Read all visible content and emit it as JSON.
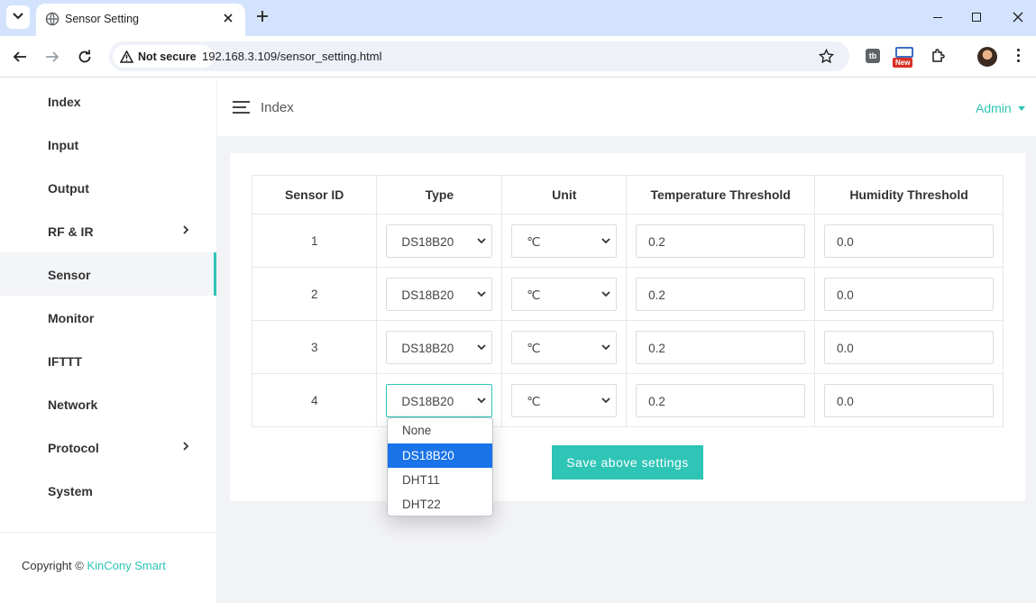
{
  "browser": {
    "tab_title": "Sensor Setting",
    "security_label": "Not secure",
    "url": "192.168.3.109/sensor_setting.html",
    "new_badge": "New",
    "ext_label": "tb"
  },
  "sidebar": {
    "items": [
      {
        "label": "Index",
        "has_submenu": false
      },
      {
        "label": "Input",
        "has_submenu": false
      },
      {
        "label": "Output",
        "has_submenu": false
      },
      {
        "label": "RF & IR",
        "has_submenu": true
      },
      {
        "label": "Sensor",
        "has_submenu": false,
        "active": true
      },
      {
        "label": "Monitor",
        "has_submenu": false
      },
      {
        "label": "IFTTT",
        "has_submenu": false
      },
      {
        "label": "Network",
        "has_submenu": false
      },
      {
        "label": "Protocol",
        "has_submenu": true
      },
      {
        "label": "System",
        "has_submenu": false
      }
    ],
    "copyright_prefix": "Copyright ©",
    "copyright_link": "KinCony Smart"
  },
  "header": {
    "breadcrumb": "Index",
    "user_menu": "Admin"
  },
  "table": {
    "headers": [
      "Sensor ID",
      "Type",
      "Unit",
      "Temperature Threshold",
      "Humidity Threshold"
    ],
    "rows": [
      {
        "id": "1",
        "type": "DS18B20",
        "unit": "℃",
        "temp_threshold": "0.2",
        "humidity_threshold": "0.0"
      },
      {
        "id": "2",
        "type": "DS18B20",
        "unit": "℃",
        "temp_threshold": "0.2",
        "humidity_threshold": "0.0"
      },
      {
        "id": "3",
        "type": "DS18B20",
        "unit": "℃",
        "temp_threshold": "0.2",
        "humidity_threshold": "0.0"
      },
      {
        "id": "4",
        "type": "DS18B20",
        "unit": "℃",
        "temp_threshold": "0.2",
        "humidity_threshold": "0.0"
      }
    ]
  },
  "type_dropdown": {
    "options": [
      "None",
      "DS18B20",
      "DHT11",
      "DHT22"
    ],
    "selected": "DS18B20"
  },
  "save_button": "Save above settings",
  "colors": {
    "accent": "#2ec4b6",
    "tab_strip": "#d3e3fd",
    "selected_option": "#1a73e8",
    "page_bg": "#f2f3f7"
  }
}
